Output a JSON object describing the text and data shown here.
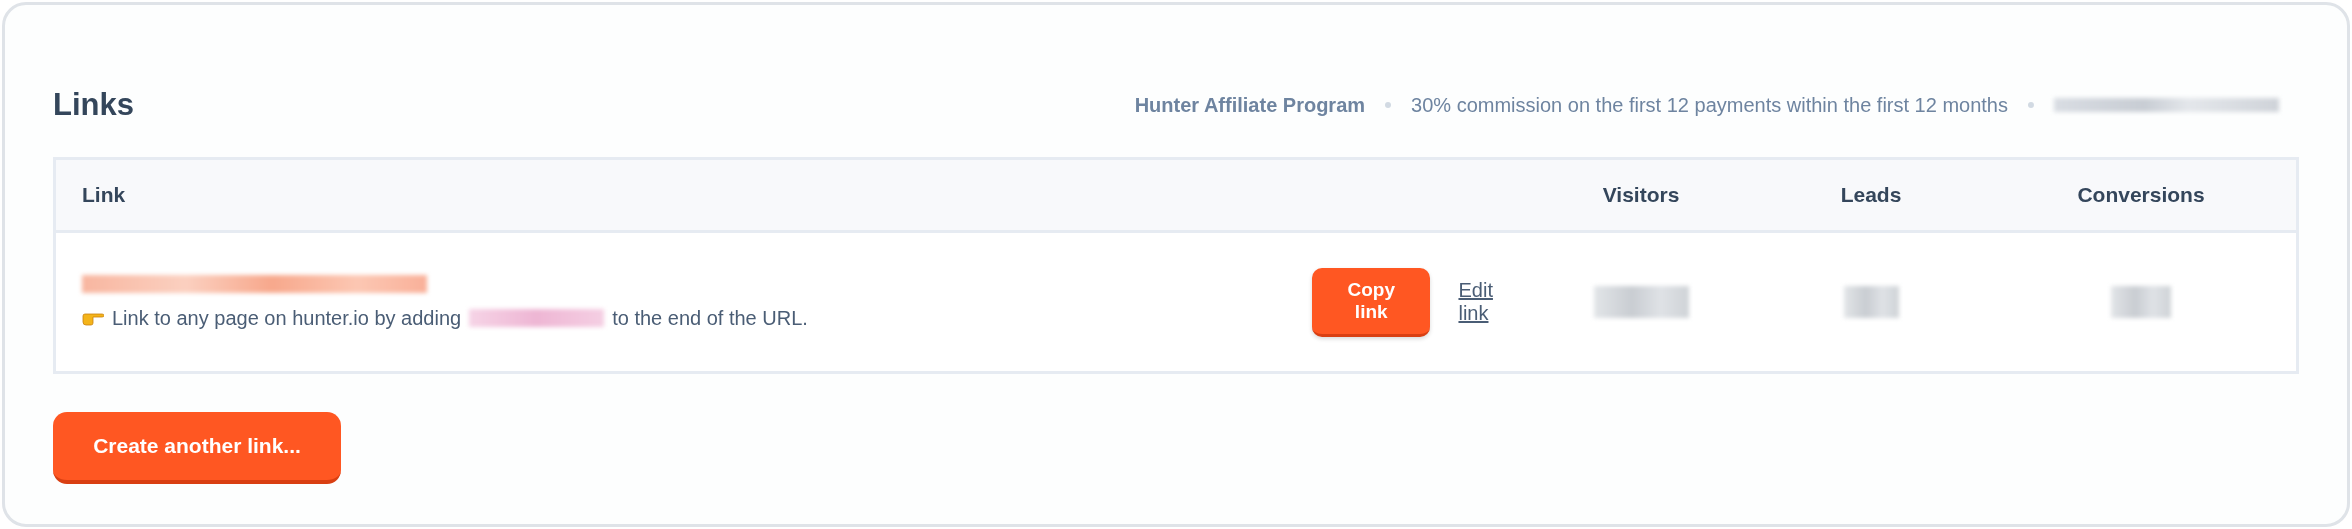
{
  "title": "Links",
  "program": {
    "name": "Hunter Affiliate Program",
    "commission": "30% commission on the first 12 payments within the first 12 months"
  },
  "table": {
    "columns": [
      "Link",
      "Visitors",
      "Leads",
      "Conversions"
    ],
    "rows": [
      {
        "hint_before": "Link to any page on hunter.io by adding",
        "hint_after": "to the end of the URL.",
        "copy_label": "Copy link",
        "edit_label": "Edit link"
      }
    ]
  },
  "create_button": "Create another link..."
}
